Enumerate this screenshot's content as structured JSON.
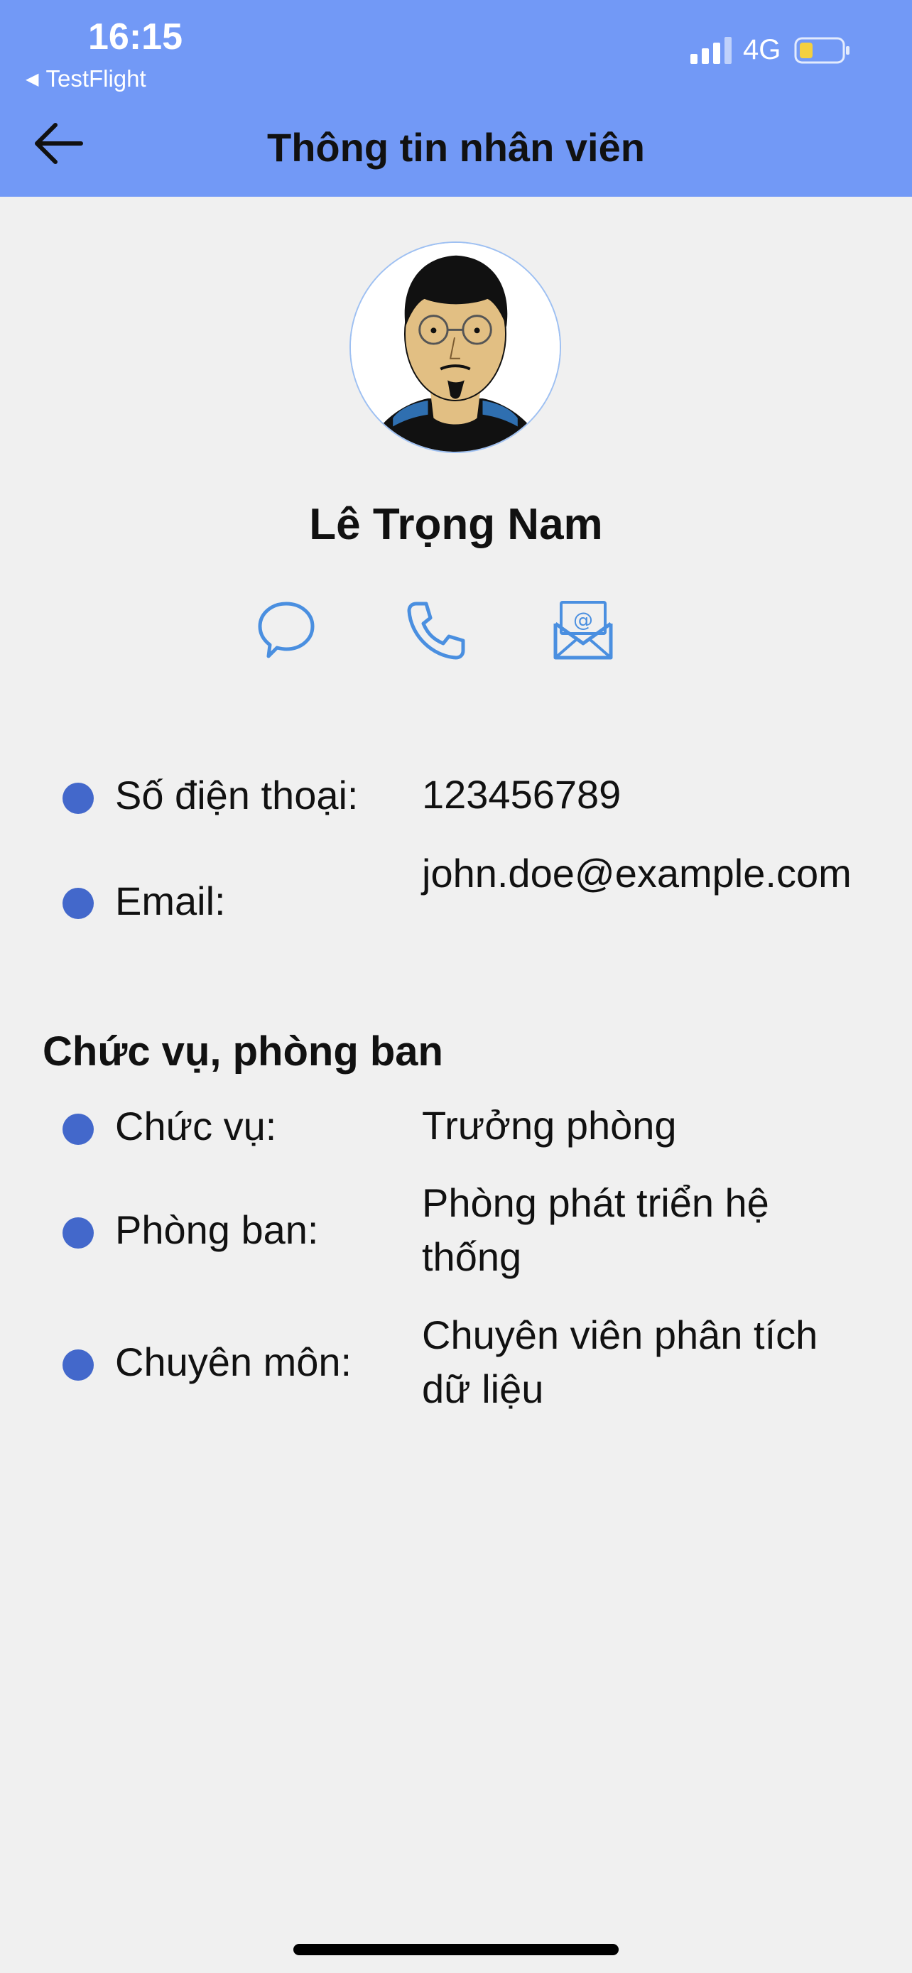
{
  "status_bar": {
    "time": "16:15",
    "back_app": "TestFlight",
    "network": "4G"
  },
  "header": {
    "title": "Thông tin nhân viên",
    "background_color": "#7299f6"
  },
  "profile": {
    "name": "Lê Trọng Nam",
    "actions": [
      {
        "icon": "chat-icon"
      },
      {
        "icon": "phone-icon"
      },
      {
        "icon": "email-icon"
      }
    ]
  },
  "contact": [
    {
      "label": "Số điện thoại:",
      "value": "123456789"
    },
    {
      "label": "Email:",
      "value": "john.doe@example.com"
    }
  ],
  "position_section": {
    "title": "Chức vụ, phòng ban",
    "items": [
      {
        "label": "Chức vụ:",
        "value": "Trưởng phòng"
      },
      {
        "label": "Phòng ban:",
        "value": "Phòng phát triển hệ thống"
      },
      {
        "label": "Chuyên môn:",
        "value": "Chuyên viên phân tích dữ liệu"
      }
    ]
  },
  "colors": {
    "accent_icon": "#4a8fe0",
    "bullet": "#4368cb"
  }
}
